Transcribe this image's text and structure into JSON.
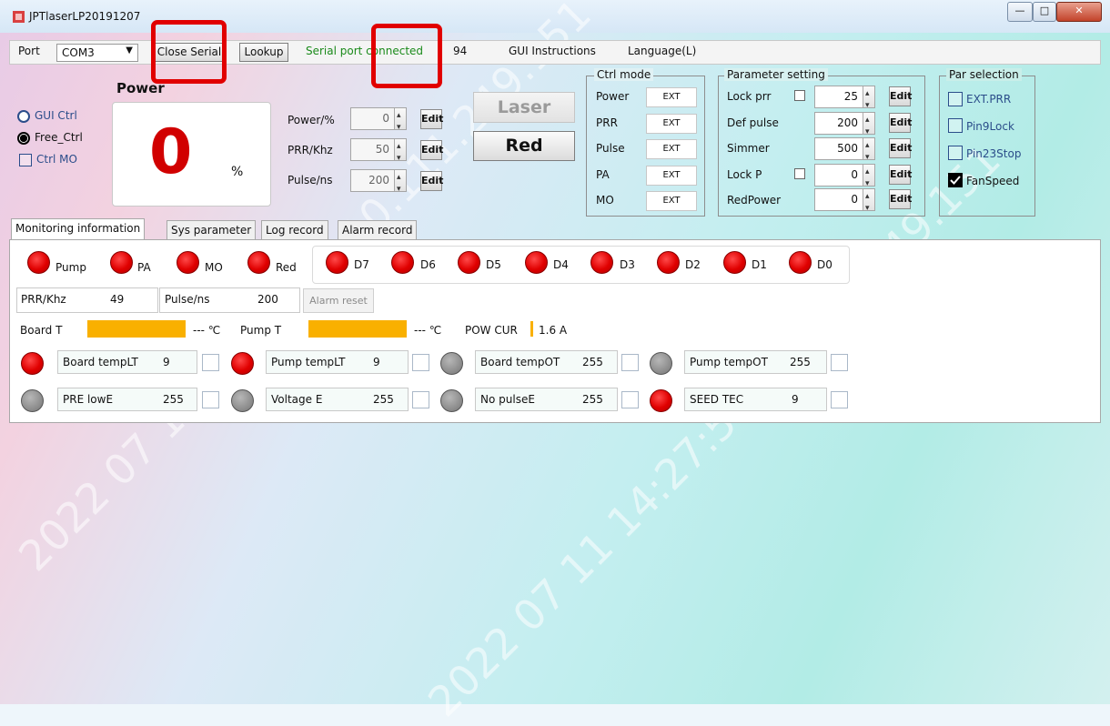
{
  "window": {
    "title": "JPTlaserLP20191207",
    "controls": [
      "minimize",
      "maximize",
      "close"
    ]
  },
  "menubar": {
    "port_label": "Port",
    "port_value": "COM3",
    "close_serial": "Close Serial",
    "lookup": "Lookup",
    "status": "Serial port connected",
    "status_color": "#1a8a1a",
    "count": "94",
    "gui_instructions": "GUI Instructions",
    "language": "Language(L)"
  },
  "mode": {
    "gui_ctrl": "GUI Ctrl",
    "free_ctrl": "Free_Ctrl",
    "ctrl_mo": "Ctrl MO",
    "selected": "Free_Ctrl"
  },
  "power_display": {
    "title": "Power",
    "value": "0",
    "unit": "%"
  },
  "settings": [
    {
      "label": "Power/%",
      "value": "0",
      "edit": "Edit"
    },
    {
      "label": "PRR/Khz",
      "value": "50",
      "edit": "Edit"
    },
    {
      "label": "Pulse/ns",
      "value": "200",
      "edit": "Edit"
    }
  ],
  "buttons": {
    "laser": "Laser",
    "red": "Red"
  },
  "ctrl_mode": {
    "title": "Ctrl mode",
    "rows": [
      {
        "label": "Power",
        "value": "EXT"
      },
      {
        "label": "PRR",
        "value": "EXT"
      },
      {
        "label": "Pulse",
        "value": "EXT"
      },
      {
        "label": "PA",
        "value": "EXT"
      },
      {
        "label": "MO",
        "value": "EXT"
      }
    ]
  },
  "param_setting": {
    "title": "Parameter setting",
    "rows": [
      {
        "label": "Lock prr",
        "value": "25",
        "edit": "Edit",
        "has_check": true
      },
      {
        "label": "Def pulse",
        "value": "200",
        "edit": "Edit",
        "has_check": false
      },
      {
        "label": "Simmer",
        "value": "500",
        "edit": "Edit",
        "has_check": false
      },
      {
        "label": "Lock P",
        "value": "0",
        "edit": "Edit",
        "has_check": true
      },
      {
        "label": "RedPower",
        "value": "0",
        "edit": "Edit",
        "has_check": false
      }
    ]
  },
  "par_selection": {
    "title": "Par selection",
    "items": [
      {
        "label": "EXT.PRR",
        "checked": false
      },
      {
        "label": "Pin9Lock",
        "checked": false
      },
      {
        "label": "Pin23Stop",
        "checked": false
      },
      {
        "label": "FanSpeed",
        "checked": true
      }
    ]
  },
  "tabs": [
    "Monitoring information",
    "Sys parameter",
    "Log record",
    "Alarm record"
  ],
  "status_leds": [
    "Pump",
    "PA",
    "MO",
    "Red"
  ],
  "bit_leds": [
    "D7",
    "D6",
    "D5",
    "D4",
    "D3",
    "D2",
    "D1",
    "D0"
  ],
  "readings": {
    "prr_label": "PRR/Khz",
    "prr_value": "49",
    "pulse_label": "Pulse/ns",
    "pulse_value": "200",
    "alarm_reset": "Alarm reset"
  },
  "temps": {
    "board_label": "Board T",
    "board_value": "--- ℃",
    "pump_label": "Pump T",
    "pump_value": "--- ℃",
    "pow_cur_label": "POW CUR",
    "pow_cur_value": "1.6 A",
    "bar_color": "#f9b000"
  },
  "alarms_row1": [
    {
      "name": "Board tempLT",
      "value": "9",
      "state": "red"
    },
    {
      "name": "Pump tempLT",
      "value": "9",
      "state": "red"
    },
    {
      "name": "Board tempOT",
      "value": "255",
      "state": "gray"
    },
    {
      "name": "Pump tempOT",
      "value": "255",
      "state": "gray"
    }
  ],
  "alarms_row2": [
    {
      "name": "PRE lowE",
      "value": "255",
      "state": "gray"
    },
    {
      "name": "Voltage E",
      "value": "255",
      "state": "gray"
    },
    {
      "name": "No pulseE",
      "value": "255",
      "state": "gray"
    },
    {
      "name": "SEED TEC",
      "value": "9",
      "state": "red"
    }
  ],
  "watermark": {
    "text": "2022 07 11 14:27:57  10.111.249.151"
  }
}
